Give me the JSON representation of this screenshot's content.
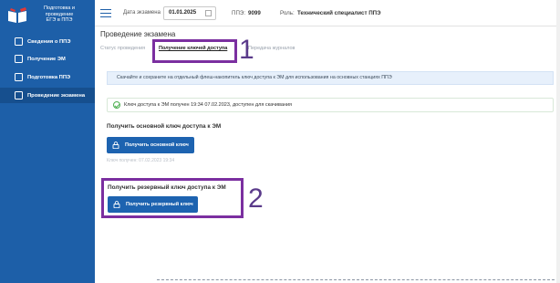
{
  "sidebar": {
    "brand": [
      "Подготовка и",
      "проведение",
      "ЕГЭ в ППЭ"
    ],
    "items": [
      {
        "label": "Сведения о ППЭ"
      },
      {
        "label": "Получение ЭМ"
      },
      {
        "label": "Подготовка ППЭ"
      },
      {
        "label": "Проведение экзамена"
      }
    ]
  },
  "topbar": {
    "date_label": "Дата экзамена",
    "date_value": "01.01.2025",
    "ppe_label": "ППЭ:",
    "ppe_value": "9099",
    "role_label": "Роль:",
    "role_value": "Технический специалист ППЭ"
  },
  "main": {
    "title": "Проведение экзамена",
    "tabs": [
      {
        "label": "Статус проведения"
      },
      {
        "label": "Получение ключей доступа"
      },
      {
        "label": "Передача журналов"
      }
    ],
    "info_text": "Скачайте и сохраните на отдельный флеш-накопитель ключ доступа к ЭМ для использования на основных станциях ППЭ",
    "status_text": "Ключ доступа к ЭМ получен 19:34 07.02.2023, доступен для скачивания",
    "main_key": {
      "title": "Получить основной ключ доступа к ЭМ",
      "button": "Получить основной ключ",
      "note": "Ключ получен: 07.02.2023 19:34"
    },
    "reserve_key": {
      "title": "Получить резервный ключ доступа к ЭМ",
      "button": "Получить резервный ключ"
    }
  },
  "annotations": [
    {
      "label": "1"
    },
    {
      "label": "2"
    }
  ],
  "colors": {
    "sidebar": "#1d5fa8",
    "button": "#1d63b0",
    "annotation": "#7b2fa0"
  }
}
